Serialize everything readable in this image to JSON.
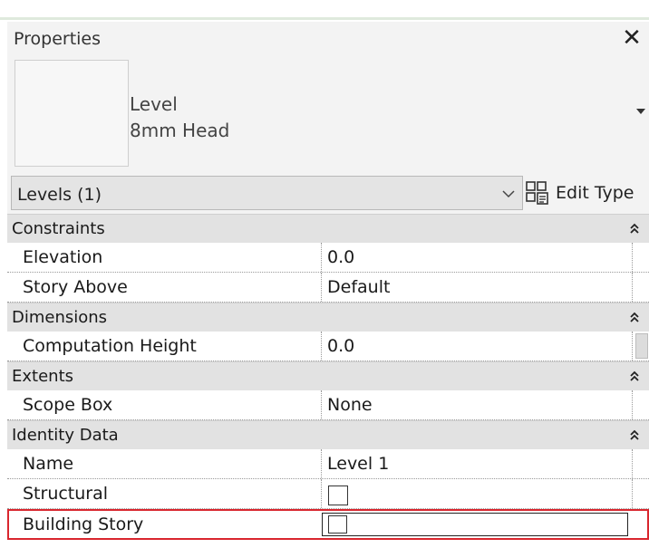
{
  "panel": {
    "title": "Properties",
    "close_icon": "close-icon"
  },
  "type_selector": {
    "family": "Level",
    "type": "8mm Head",
    "dropdown_icon": "triangle-down-icon"
  },
  "instance_filter": {
    "value": "Levels (1)",
    "chevron_icon": "chevron-down-icon"
  },
  "edit_type": {
    "label": "Edit Type",
    "icon": "edit-type-icon"
  },
  "groups": [
    {
      "label": "Constraints",
      "params": [
        {
          "name": "Elevation",
          "value": "0.0"
        },
        {
          "name": "Story Above",
          "value": "Default"
        }
      ]
    },
    {
      "label": "Dimensions",
      "params": [
        {
          "name": "Computation Height",
          "value": "0.0"
        }
      ]
    },
    {
      "label": "Extents",
      "params": [
        {
          "name": "Scope Box",
          "value": "None"
        }
      ]
    },
    {
      "label": "Identity Data",
      "params": [
        {
          "name": "Name",
          "value": "Level 1"
        },
        {
          "name": "Structural",
          "value": "",
          "checked": false
        },
        {
          "name": "Building Story",
          "value": "",
          "checked": false,
          "highlighted": true
        }
      ]
    }
  ],
  "colors": {
    "highlight": "#d9262e",
    "group_header": "#e2e2e2",
    "panel_bg": "#f3f3f3"
  }
}
